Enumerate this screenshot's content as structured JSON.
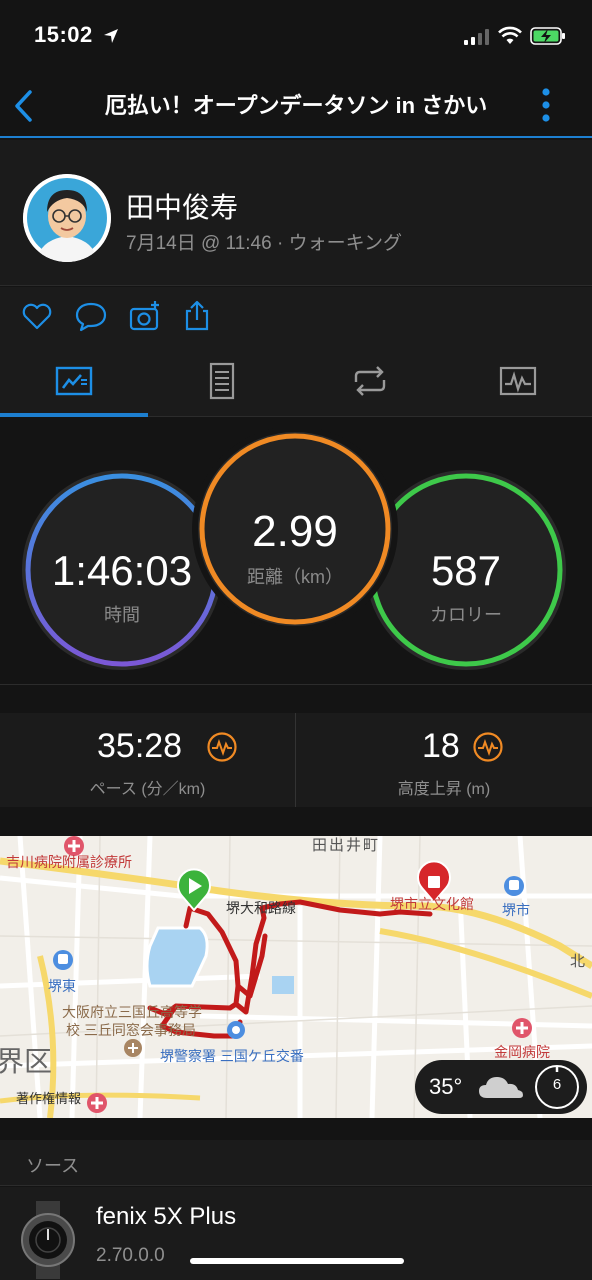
{
  "status": {
    "time": "15:02"
  },
  "header": {
    "title": "厄払い！オープンデータソン in さかい"
  },
  "profile": {
    "name": "田中俊寿",
    "meta": "7月14日 @ 11:46 · ウォーキング"
  },
  "tabs": [
    "overview-icon",
    "details-icon",
    "laps-icon",
    "charts-icon"
  ],
  "circles": {
    "time": {
      "value": "1:46:03",
      "label": "時間"
    },
    "distance": {
      "value": "2.99",
      "label": "距離（km）"
    },
    "calories": {
      "value": "587",
      "label": "カロリー"
    }
  },
  "stats": {
    "pace": {
      "value": "35:28",
      "label": "ペース (分／km)"
    },
    "elevation": {
      "value": "18",
      "label": "高度上昇 (m)"
    }
  },
  "map": {
    "labels": {
      "l1": "吉川病院附属診療所",
      "l2": "田出井町",
      "l3": "堺大和路線",
      "l4": "堺市立文化館",
      "l5": "堺市",
      "l6": "北",
      "l7": "堺東",
      "l8": "大阪府立三国丘高等学",
      "l9": "校 三丘同窓会事務局",
      "l10": "界区",
      "l11": "堺警察署 三国ケ丘交番",
      "l12": "金岡病院",
      "l13": "著作権情報"
    },
    "weather": {
      "temp": "35°",
      "wind": "6"
    }
  },
  "sources": {
    "title": "ソース",
    "device_name": "fenix 5X Plus",
    "device_version": "2.70.0.0"
  },
  "colors": {
    "accent": "#1d7fd0",
    "time_ring": "#6a63d6",
    "distance_ring": "#f08a24",
    "calories_ring": "#3ec94a",
    "route": "#c21a1a"
  }
}
